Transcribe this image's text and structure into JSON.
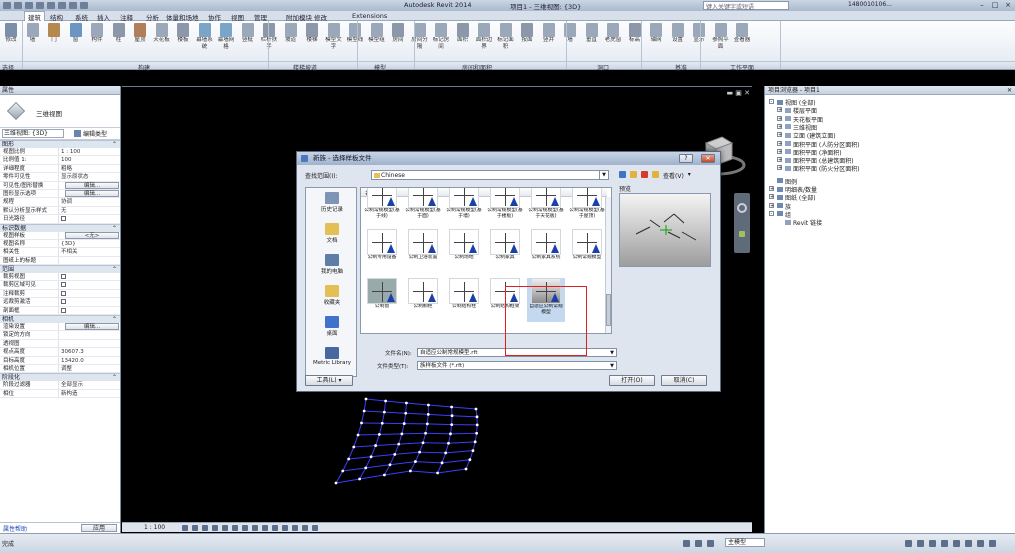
{
  "titlebar": {
    "title": "Autodesk Revit 2014",
    "subtitle": "项目1 - 三维视图: {3D}",
    "search_placeholder": "键入关键字或短语",
    "user": "1480010106..."
  },
  "ribbon": {
    "tabs": [
      "建筑",
      "结构",
      "系统",
      "插入",
      "注释",
      "分析",
      "体量和场地",
      "协作",
      "视图",
      "管理",
      "附加模块",
      "修改",
      "Extensions"
    ],
    "active_tab": "建筑",
    "select_label": "选择",
    "buttons": [
      {
        "label": "修改",
        "color": "#7b8fab"
      },
      {
        "label": "墙",
        "color": "#9aa8ba"
      },
      {
        "label": "门",
        "color": "#b58850"
      },
      {
        "label": "窗",
        "color": "#6b96c4"
      },
      {
        "label": "构件",
        "color": "#9aa8ba"
      },
      {
        "label": "柱",
        "color": "#8c98aa"
      },
      {
        "label": "屋顶",
        "color": "#b07f5a"
      },
      {
        "label": "天花板",
        "color": "#9aa8ba"
      },
      {
        "label": "楼板",
        "color": "#8c98aa"
      },
      {
        "label": "幕墙系统",
        "color": "#7aa4c8"
      },
      {
        "label": "幕墙网格",
        "color": "#7aa4c8"
      },
      {
        "label": "竖梃",
        "color": "#9aa8ba"
      },
      {
        "label": "栏杆扶手",
        "color": "#8c98aa"
      },
      {
        "label": "坡道",
        "color": "#9aa8ba"
      },
      {
        "label": "楼梯",
        "color": "#8c98aa"
      },
      {
        "label": "模型文字",
        "color": "#9aa8ba"
      },
      {
        "label": "模型线",
        "color": "#9aa8ba"
      },
      {
        "label": "模型组",
        "color": "#9aa8ba"
      },
      {
        "label": "房间",
        "color": "#8c98aa"
      },
      {
        "label": "房间分隔",
        "color": "#9aa8ba"
      },
      {
        "label": "标记房间",
        "color": "#9aa8ba"
      },
      {
        "label": "面积",
        "color": "#8c98aa"
      },
      {
        "label": "面积边界",
        "color": "#9aa8ba"
      },
      {
        "label": "标记面积",
        "color": "#9aa8ba"
      },
      {
        "label": "按面",
        "color": "#8c98aa"
      },
      {
        "label": "竖井",
        "color": "#9aa8ba"
      },
      {
        "label": "墙",
        "color": "#9aa8ba"
      },
      {
        "label": "垂直",
        "color": "#9aa8ba"
      },
      {
        "label": "老虎窗",
        "color": "#9aa8ba"
      },
      {
        "label": "标高",
        "color": "#8c98aa"
      },
      {
        "label": "轴网",
        "color": "#9aa8ba"
      },
      {
        "label": "设置",
        "color": "#9aa8ba"
      },
      {
        "label": "显示",
        "color": "#9aa8ba"
      },
      {
        "label": "参照平面",
        "color": "#9aa8ba"
      },
      {
        "label": "查看器",
        "color": "#9aa8ba"
      }
    ],
    "groups": [
      "构建",
      "楼梯坡道",
      "模型",
      "房间和面积",
      "洞口",
      "基准",
      "工作平面"
    ]
  },
  "properties": {
    "title": "属性",
    "type_name": "三维视图",
    "view_selector": "三维视图: {3D}",
    "edit_type": "编辑类型",
    "sections": [
      {
        "name": "图形",
        "rows": [
          {
            "k": "视图比例",
            "v": "1 : 100"
          },
          {
            "k": "比例值 1:",
            "v": "100"
          },
          {
            "k": "详细程度",
            "v": "粗略"
          },
          {
            "k": "零件可见性",
            "v": "显示原状态"
          },
          {
            "k": "可见性/图形替换",
            "v": "",
            "btn": "编辑..."
          },
          {
            "k": "图形显示选项",
            "v": "",
            "btn": "编辑..."
          },
          {
            "k": "规程",
            "v": "协调"
          },
          {
            "k": "默认分析显示样式",
            "v": "无"
          },
          {
            "k": "日光路径",
            "v": "",
            "chk": true
          }
        ]
      },
      {
        "name": "标识数据",
        "rows": [
          {
            "k": "视图样板",
            "v": "",
            "btn": "<无>"
          },
          {
            "k": "视图名称",
            "v": "{3D}"
          },
          {
            "k": "相关性",
            "v": "不相关"
          },
          {
            "k": "图纸上的标题",
            "v": ""
          }
        ]
      },
      {
        "name": "范围",
        "rows": [
          {
            "k": "裁剪视图",
            "v": "",
            "chk": true
          },
          {
            "k": "裁剪区域可见",
            "v": "",
            "chk": true
          },
          {
            "k": "注释裁剪",
            "v": "",
            "chk": true
          },
          {
            "k": "远裁剪激活",
            "v": "",
            "chk": true
          },
          {
            "k": "剖面框",
            "v": "",
            "chk": true
          }
        ]
      },
      {
        "name": "相机",
        "rows": [
          {
            "k": "渲染设置",
            "v": "",
            "btn": "编辑..."
          },
          {
            "k": "锁定的方向",
            "v": ""
          },
          {
            "k": "透视图",
            "v": ""
          },
          {
            "k": "视点高度",
            "v": "30607.3"
          },
          {
            "k": "目标高度",
            "v": "13420.0"
          },
          {
            "k": "相机位置",
            "v": "调整"
          }
        ]
      },
      {
        "name": "阶段化",
        "rows": [
          {
            "k": "阶段过滤器",
            "v": "全部显示"
          },
          {
            "k": "相位",
            "v": "新构造"
          }
        ]
      }
    ],
    "help_link": "属性帮助",
    "apply": "应用"
  },
  "viewport": {
    "scale": "1 : 100"
  },
  "browser": {
    "title": "项目浏览器 - 项目1",
    "tree": [
      {
        "label": "视图 (全部)",
        "level": 0,
        "toggle": "-"
      },
      {
        "label": "楼层平面",
        "level": 1,
        "toggle": "+"
      },
      {
        "label": "天花板平面",
        "level": 1,
        "toggle": "+"
      },
      {
        "label": "三维视图",
        "level": 1,
        "toggle": "+"
      },
      {
        "label": "立面 (建筑立面)",
        "level": 1,
        "toggle": "+"
      },
      {
        "label": "面积平面 (人防分区面积)",
        "level": 1,
        "toggle": "+"
      },
      {
        "label": "面积平面 (净面积)",
        "level": 1,
        "toggle": "+"
      },
      {
        "label": "面积平面 (总建筑面积)",
        "level": 1,
        "toggle": "+"
      },
      {
        "label": "面积平面 (防火分区面积)",
        "level": 1,
        "toggle": "+"
      },
      {
        "label": "图例",
        "level": 0,
        "toggle": ""
      },
      {
        "label": "明细表/数量",
        "level": 0,
        "toggle": "+"
      },
      {
        "label": "图纸 (全部)",
        "level": 0,
        "toggle": "+"
      },
      {
        "label": "族",
        "level": 0,
        "toggle": "+"
      },
      {
        "label": "组",
        "level": 0,
        "toggle": "-"
      },
      {
        "label": "Revit 链接",
        "level": 1,
        "toggle": ""
      }
    ]
  },
  "statusbar": {
    "message": "完成",
    "workset": "主模型"
  },
  "dialog": {
    "title": "新族 - 选择样板文件",
    "look_in_label": "查找范围(I):",
    "path": "Chinese",
    "views_label": "查看(V)",
    "columns": [
      "名称",
      "修改日期",
      "类型",
      "大小"
    ],
    "places": [
      "历史记录",
      "文档",
      "我的电脑",
      "收藏夹",
      "桌面",
      "Metric Library"
    ],
    "files": [
      "公制常规模型(基于线)",
      "公制常规模型(基于面)",
      "公制常规模型(基于墙)",
      "公制常规模型(基于楼板)",
      "公制常规模型(基于天花板)",
      "公制常规模型(基于屋顶)",
      "公制专用设备",
      "公制卫浴装置",
      "公制场地",
      "公制家具",
      "公制家具系统",
      "公制常规模型",
      "公制窗",
      "公制橱柜",
      "公制结构柱",
      "公制结构框架",
      "自适应公制常规模型"
    ],
    "selected_file": "自适应公制常规模型",
    "preview_label": "预览",
    "filename_label": "文件名(N):",
    "filename_value": "自适应公制常规模型.rft",
    "filetype_label": "文件类型(T):",
    "filetype_value": "族样板文件 (*.rft)",
    "tools_button": "工具(L)",
    "open_button": "打开(O)",
    "cancel_button": "取消(C)"
  }
}
